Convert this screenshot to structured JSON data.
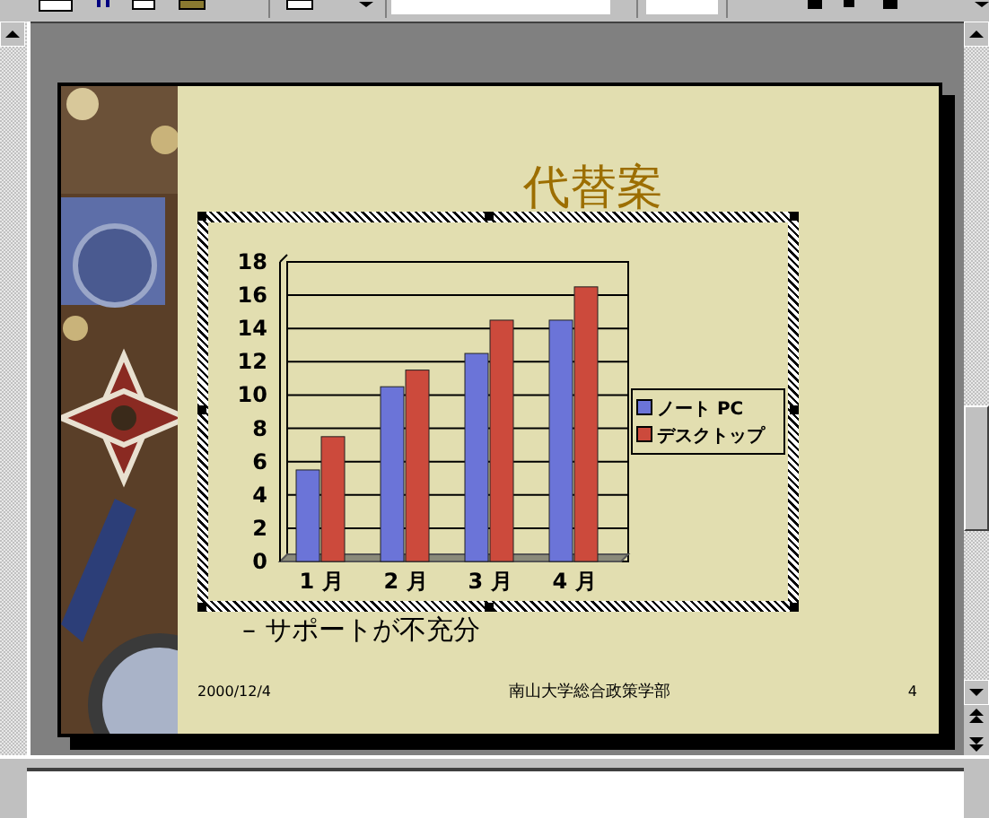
{
  "slide": {
    "title": "代替案",
    "chart": {
      "chart_data": {
        "type": "bar",
        "categories": [
          "1 月",
          "2 月",
          "3 月",
          "4 月"
        ],
        "series": [
          {
            "name": "ノート PC",
            "color": "#6b74d8",
            "values": [
              5.5,
              10.5,
              12.5,
              14.5
            ]
          },
          {
            "name": "デスクトップ",
            "color": "#cc4a3c",
            "values": [
              7.5,
              11.5,
              14.5,
              16.5
            ]
          }
        ],
        "ylim": [
          0,
          18
        ],
        "grid": true,
        "legend": "right",
        "yticks": [
          0,
          2,
          4,
          6,
          8,
          10,
          12,
          14,
          16,
          18
        ]
      }
    },
    "bullet": "– サポートが不充分",
    "footer": {
      "date": "2000/12/4",
      "organization": "南山大学総合政策学部",
      "page": "4"
    }
  }
}
